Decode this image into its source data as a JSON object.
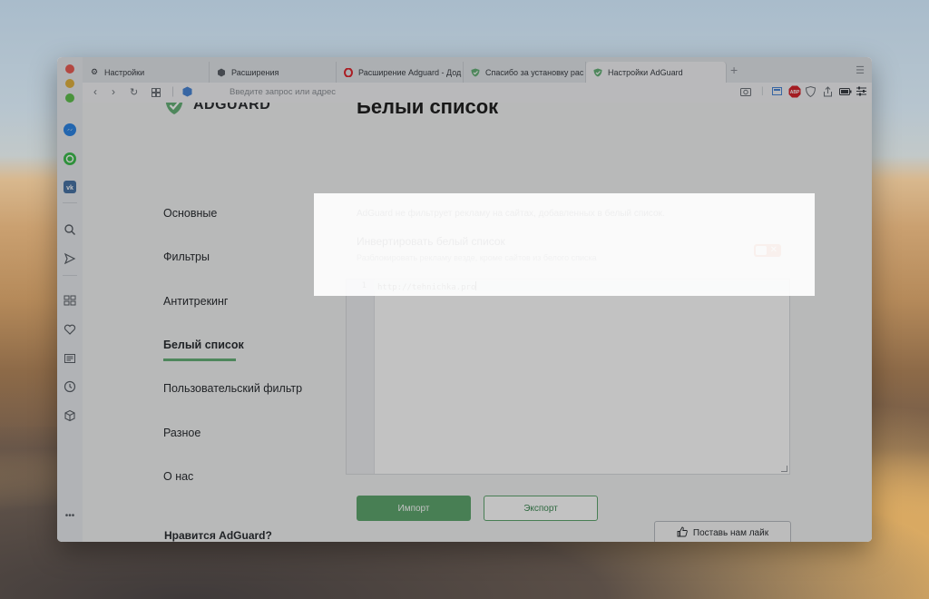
{
  "browser": {
    "tabs": [
      {
        "label": "Настройки",
        "icon": "gear-icon"
      },
      {
        "label": "Расширения",
        "icon": "cube-icon"
      },
      {
        "label": "Расширение Adguard - Дод",
        "icon": "opera-icon"
      },
      {
        "label": "Спасибо за установку рас",
        "icon": "adguard-shield-icon"
      },
      {
        "label": "Настройки AdGuard",
        "icon": "adguard-shield-icon"
      }
    ],
    "address_placeholder": "Введите запрос или адрес",
    "abp_badge": "ABP"
  },
  "rail_more": "•••",
  "page": {
    "logo_text": "ADGUARD",
    "title": "Белый список",
    "sidebar": [
      "Основные",
      "Фильтры",
      "Антитрекинг",
      "Белый список",
      "Пользовательский фильтр",
      "Разное",
      "О нас"
    ],
    "active_index": 3,
    "description": "AdGuard не фильтрует рекламу на сайтах, добавленных в белый список.",
    "invert_title": "Инвертировать белый список",
    "invert_subtitle": "Разблокировать рекламу везде, кроме сайтов из белого списка",
    "toggle_symbol": "✕",
    "editor_lines": [
      {
        "no": "1",
        "text": "http://tehnichka.pro"
      }
    ],
    "import_label": "Импорт",
    "export_label": "Экспорт",
    "footer_text": "Нравится AdGuard?",
    "like_label": "Поставь нам лайк"
  },
  "colors": {
    "accent_green": "#67b279",
    "toggle_orange": "#e4612d"
  }
}
